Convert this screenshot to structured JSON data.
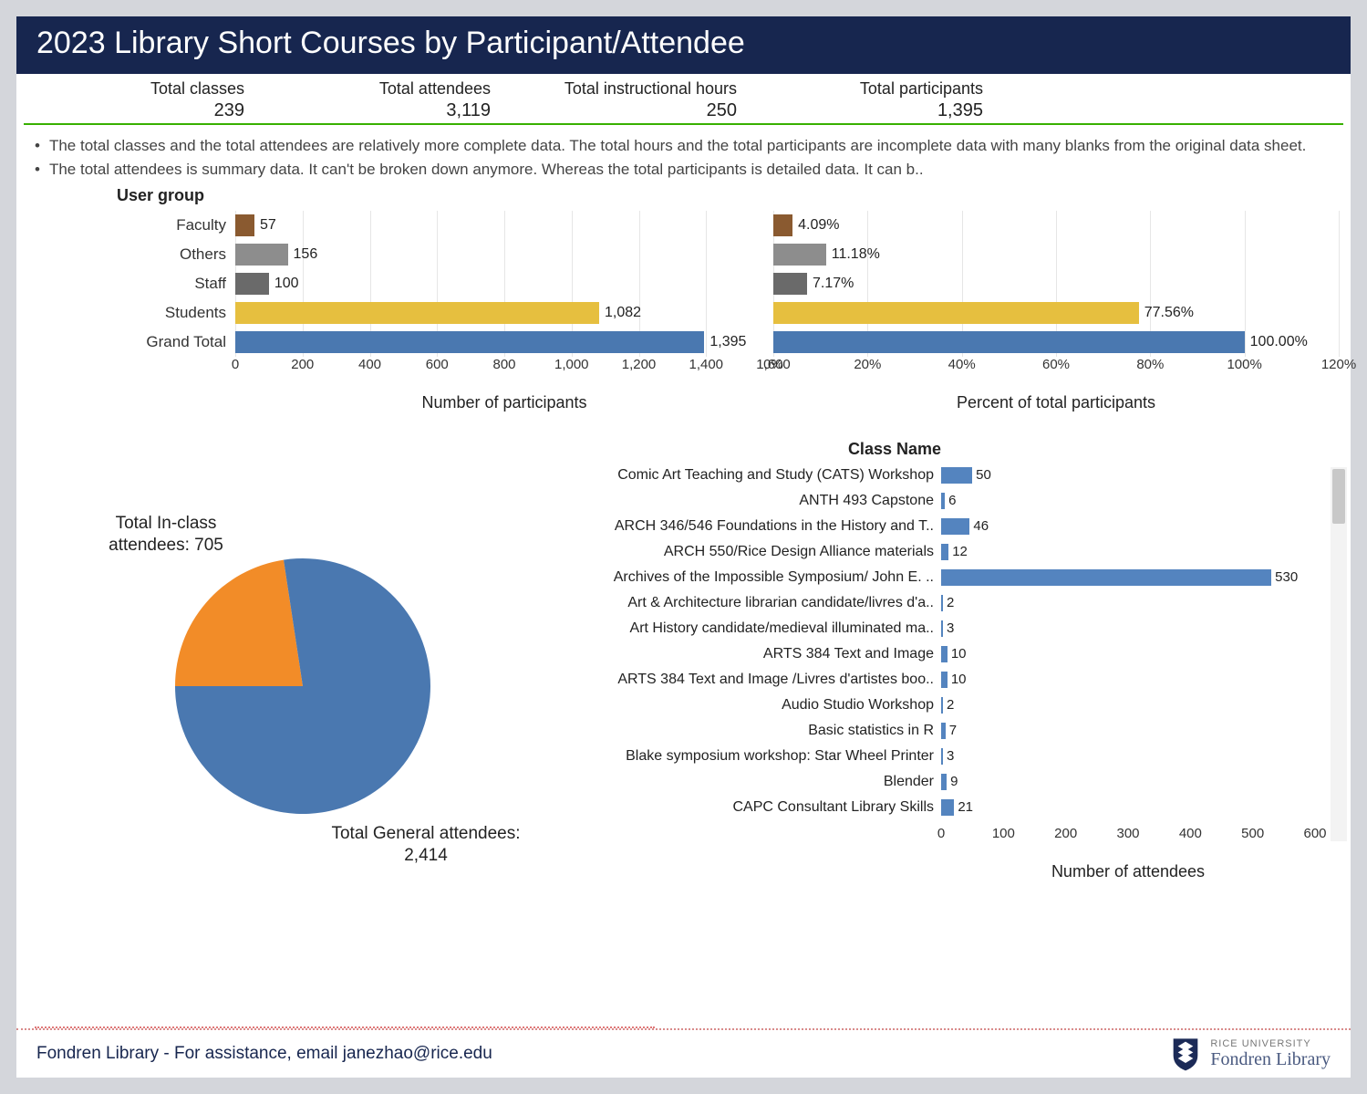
{
  "title": "2023 Library Short Courses by Participant/Attendee",
  "kpis": [
    {
      "label": "Total classes",
      "value": "239"
    },
    {
      "label": "Total attendees",
      "value": "3,119"
    },
    {
      "label": "Total instructional hours",
      "value": "250"
    },
    {
      "label": "Total participants",
      "value": "1,395"
    }
  ],
  "notes": [
    "The total classes and the total attendees are relatively more complete data. The total hours and the total participants are incomplete data with many blanks from the original data sheet.",
    "The total attendees is summary data. It can't be broken down anymore.  Whereas the total participants is detailed data. It can b.."
  ],
  "user_group": {
    "title": "User group",
    "rows": [
      {
        "label": "Faculty",
        "value": 57,
        "pct": "4.09%",
        "pctv": 4.09,
        "color": "#8a5a30"
      },
      {
        "label": "Others",
        "value": 156,
        "pct": "11.18%",
        "pctv": 11.18,
        "color": "#8d8d8d"
      },
      {
        "label": "Staff",
        "value": 100,
        "pct": "7.17%",
        "pctv": 7.17,
        "color": "#6a6a6a"
      },
      {
        "label": "Students",
        "value": 1082,
        "pct": "77.56%",
        "pctv": 77.56,
        "color": "#e6bf3f"
      },
      {
        "label": "Grand Total",
        "value": 1395,
        "pct": "100.00%",
        "pctv": 100.0,
        "color": "#4a78b0"
      }
    ],
    "num_axis": {
      "max": 1600,
      "ticks": [
        "0",
        "200",
        "400",
        "600",
        "800",
        "1,000",
        "1,200",
        "1,400",
        "1,600"
      ],
      "label": "Number of participants"
    },
    "pct_axis": {
      "max": 120,
      "ticks": [
        "0%",
        "20%",
        "40%",
        "60%",
        "80%",
        "100%",
        "120%"
      ],
      "label": "Percent of total participants"
    }
  },
  "pie": {
    "inclass": {
      "label": "Total  In-class attendees: 705",
      "value": 705
    },
    "general": {
      "label": "Total  General attendees: 2,414",
      "value": 2414
    }
  },
  "classes": {
    "title": "Class Name",
    "axis": {
      "max": 600,
      "ticks": [
        "0",
        "100",
        "200",
        "300",
        "400",
        "500",
        "600"
      ],
      "label": "Number of attendees"
    },
    "rows": [
      {
        "label": "Comic Art Teaching and Study (CATS) Workshop",
        "value": 50
      },
      {
        "label": "ANTH 493 Capstone",
        "value": 6
      },
      {
        "label": "ARCH 346/546 Foundations in the History and T..",
        "value": 46
      },
      {
        "label": "ARCH 550/Rice Design Alliance materials",
        "value": 12
      },
      {
        "label": "Archives of the Impossible Symposium/ John E. ..",
        "value": 530
      },
      {
        "label": "Art & Architecture librarian candidate/livres d'a..",
        "value": 2
      },
      {
        "label": "Art History candidate/medieval illuminated ma..",
        "value": 3
      },
      {
        "label": "ARTS 384 Text and Image",
        "value": 10
      },
      {
        "label": "ARTS 384 Text and Image /Livres d'artistes boo..",
        "value": 10
      },
      {
        "label": "Audio Studio Workshop",
        "value": 2
      },
      {
        "label": "Basic statistics in R",
        "value": 7
      },
      {
        "label": "Blake symposium workshop: Star Wheel Printer",
        "value": 3
      },
      {
        "label": "Blender",
        "value": 9
      },
      {
        "label": "CAPC Consultant Library Skills",
        "value": 21
      }
    ]
  },
  "footer": "Fondren Library - For assistance, email janezhao@rice.edu",
  "logo": {
    "univ": "RICE UNIVERSITY",
    "lib": "Fondren Library"
  },
  "chart_data": {
    "kpi_table": {
      "Total classes": 239,
      "Total attendees": 3119,
      "Total instructional hours": 250,
      "Total participants": 1395
    },
    "user_group_bars": {
      "type": "bar",
      "categories": [
        "Faculty",
        "Others",
        "Staff",
        "Students",
        "Grand Total"
      ],
      "series": [
        {
          "name": "Number of participants",
          "values": [
            57,
            156,
            100,
            1082,
            1395
          ]
        },
        {
          "name": "Percent of total participants",
          "values": [
            4.09,
            11.18,
            7.17,
            77.56,
            100.0
          ]
        }
      ],
      "xlabel_left": "Number of participants",
      "xlim_left": [
        0,
        1600
      ],
      "xlabel_right": "Percent of total participants",
      "xlim_right": [
        0,
        120
      ]
    },
    "attendees_pie": {
      "type": "pie",
      "slices": [
        {
          "name": "Total In-class attendees",
          "value": 705
        },
        {
          "name": "Total General attendees",
          "value": 2414
        }
      ]
    },
    "class_attendees": {
      "type": "bar",
      "xlabel": "Number of attendees",
      "xlim": [
        0,
        600
      ],
      "categories": [
        "Comic Art Teaching and Study (CATS) Workshop",
        "ANTH 493 Capstone",
        "ARCH 346/546 Foundations in the History and T..",
        "ARCH 550/Rice Design Alliance materials",
        "Archives of the Impossible Symposium/ John E. ..",
        "Art & Architecture librarian candidate/livres d'a..",
        "Art History candidate/medieval illuminated ma..",
        "ARTS 384 Text and Image",
        "ARTS 384 Text and Image /Livres d'artistes boo..",
        "Audio Studio Workshop",
        "Basic statistics in R",
        "Blake symposium workshop: Star Wheel Printer",
        "Blender",
        "CAPC Consultant Library Skills"
      ],
      "values": [
        50,
        6,
        46,
        12,
        530,
        2,
        3,
        10,
        10,
        2,
        7,
        3,
        9,
        21
      ]
    }
  }
}
